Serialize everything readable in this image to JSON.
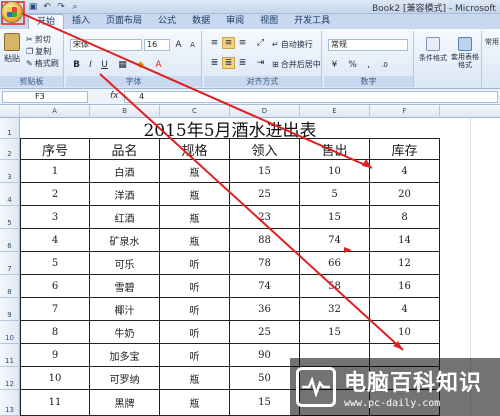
{
  "window": {
    "title": "Book2 [兼容模式] - Microsoft"
  },
  "quick_access": [
    "save-icon",
    "undo-icon",
    "redo-icon",
    "print-preview-icon"
  ],
  "tabs": [
    "开始",
    "插入",
    "页面布局",
    "公式",
    "数据",
    "审阅",
    "视图",
    "开发工具"
  ],
  "ribbon": {
    "clipboard": {
      "paste": "粘贴",
      "cut": "剪切",
      "copy": "复制",
      "format_painter": "格式刷",
      "label": "剪贴板"
    },
    "font": {
      "name": "宋体",
      "size": "16",
      "label": "字体",
      "bold": "B",
      "italic": "I",
      "underline": "U"
    },
    "alignment": {
      "wrap": "自动换行",
      "merge": "合并后居中",
      "label": "对齐方式"
    },
    "number": {
      "format": "常规",
      "percent": "%",
      "comma": ",",
      "label": "数字"
    },
    "styles": {
      "conditional": "条件格式",
      "table": "套用表格格式",
      "cell_styles": "单元格样式"
    },
    "extra": {
      "label": "常用"
    }
  },
  "formula_bar": {
    "cell_ref": "F3",
    "fx": "fx",
    "content": "4"
  },
  "columns": [
    "A",
    "B",
    "C",
    "D",
    "E",
    "F"
  ],
  "rows": [
    "1",
    "2",
    "3",
    "4",
    "5",
    "6",
    "7",
    "8",
    "9",
    "10",
    "11",
    "12",
    "13"
  ],
  "sheet": {
    "title": "2015年5月酒水进出表",
    "headers": [
      "序号",
      "品名",
      "规格",
      "领入",
      "售出",
      "库存"
    ],
    "data": [
      [
        "1",
        "白酒",
        "瓶",
        "15",
        "10",
        "4"
      ],
      [
        "2",
        "洋酒",
        "瓶",
        "25",
        "5",
        "20"
      ],
      [
        "3",
        "红酒",
        "瓶",
        "23",
        "15",
        "8"
      ],
      [
        "4",
        "矿泉水",
        "瓶",
        "88",
        "74",
        "14"
      ],
      [
        "5",
        "可乐",
        "听",
        "78",
        "66",
        "12"
      ],
      [
        "6",
        "雪碧",
        "听",
        "74",
        "58",
        "16"
      ],
      [
        "7",
        "椰汁",
        "听",
        "36",
        "32",
        "4"
      ],
      [
        "8",
        "牛奶",
        "听",
        "25",
        "15",
        "10"
      ],
      [
        "9",
        "加多宝",
        "听",
        "90",
        "",
        ""
      ],
      [
        "10",
        "可罗纳",
        "瓶",
        "50",
        "",
        ""
      ],
      [
        "11",
        "黑牌",
        "瓶",
        "15",
        "",
        ""
      ]
    ]
  },
  "watermark": {
    "main": "电脑百科知识",
    "url": "www.pc-daily.com"
  },
  "colors": {
    "arrow": "#e02020",
    "accent": "#c7d8ef"
  }
}
